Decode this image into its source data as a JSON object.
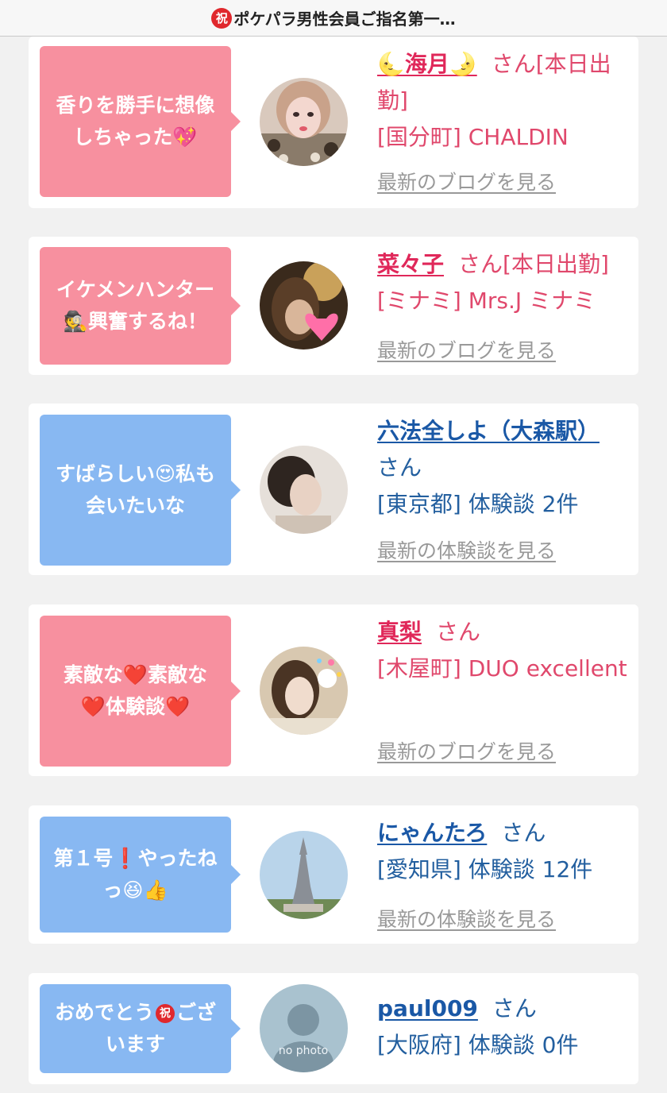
{
  "header": {
    "badge": "祝",
    "title": "ポケパラ男性会員ご指名第一…"
  },
  "cards": [
    {
      "message_lines": [
        "香りを勝手に想像",
        "しちゃった💖"
      ],
      "name": "🌜海月🌛",
      "suffix": "さん[本日出勤]",
      "detail": "[国分町] CHALDIN",
      "link": "最新のブログを見る"
    },
    {
      "message_lines": [
        "イケメンハンター",
        "🕵興奮するね！"
      ],
      "name": "菜々子",
      "suffix": "さん[本日出勤]",
      "detail": "[ミナミ] Mrs.J ミナミ",
      "link": "最新のブログを見る"
    },
    {
      "message_lines": [
        "すばらしい😍私も",
        "会いたいな"
      ],
      "name": "六法全しよ（大森駅）",
      "suffix": "さん",
      "detail": "[東京都] 体験談 2件",
      "link": "最新の体験談を見る"
    },
    {
      "message_lines": [
        "素敵な❤️素敵な",
        "❤️体験談❤️"
      ],
      "name": "真梨",
      "suffix": "さん",
      "detail": "[木屋町] DUO excellent",
      "link": "最新のブログを見る"
    },
    {
      "message_lines": [
        "第１号❗やったね",
        "っ😆👍"
      ],
      "name": "にゃんたろ",
      "suffix": "さん",
      "detail": "[愛知県] 体験談 12件",
      "link": "最新の体験談を見る"
    },
    {
      "message_pre": "おめでとう",
      "message_badge": "祝",
      "message_post": "ござ",
      "message_line2": "います",
      "name": "paul009",
      "suffix": "さん",
      "detail": "[大阪府] 体験談 0件",
      "avatar_text": "no photo"
    }
  ]
}
